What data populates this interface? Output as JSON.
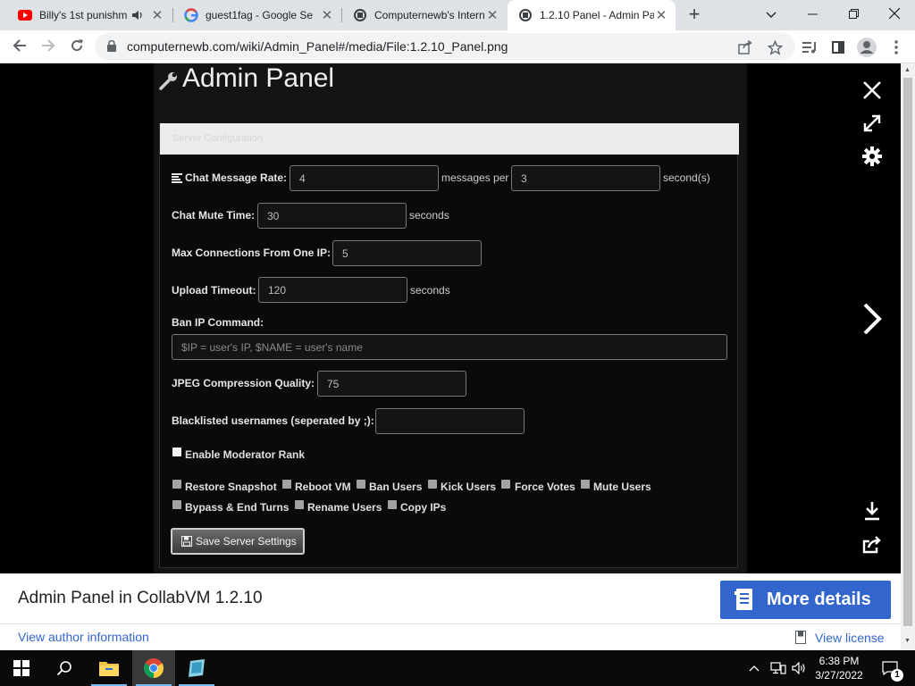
{
  "browser": {
    "tabs": [
      {
        "title": "Billy's 1st punishme",
        "icon": "youtube-icon"
      },
      {
        "title": "guest1fag - Google Se",
        "icon": "google-icon"
      },
      {
        "title": "Computernewb's Intern",
        "icon": "wiki-icon"
      },
      {
        "title": "1.2.10 Panel - Admin Pa",
        "icon": "wiki-icon",
        "active": true
      }
    ],
    "url": "computernewb.com/wiki/Admin_Panel#/media/File:1.2.10_Panel.png"
  },
  "panel": {
    "title": "Admin Panel",
    "card_header": "Server Configuration",
    "chat_rate": {
      "label": "Chat Message Rate:",
      "value1": "4",
      "mid": "messages per",
      "value2": "3",
      "suffix": "second(s)"
    },
    "mute_time": {
      "label": "Chat Mute Time:",
      "value": "30",
      "suffix": "seconds"
    },
    "max_conn": {
      "label": "Max Connections From One IP:",
      "value": "5"
    },
    "upload_timeout": {
      "label": "Upload Timeout:",
      "value": "120",
      "suffix": "seconds"
    },
    "ban_ip": {
      "label": "Ban IP Command:",
      "placeholder": "$IP = user's IP, $NAME = user's name"
    },
    "jpeg": {
      "label": "JPEG Compression Quality:",
      "value": "75"
    },
    "blacklist": {
      "label": "Blacklisted usernames (seperated by ;):",
      "value": ""
    },
    "enable_mod": "Enable Moderator Rank",
    "mod_perms": [
      "Restore Snapshot",
      "Reboot VM",
      "Ban Users",
      "Kick Users",
      "Force Votes",
      "Mute Users",
      "Bypass & End Turns",
      "Rename Users",
      "Copy IPs"
    ],
    "save_label": "Save Server Settings"
  },
  "footer": {
    "caption": "Admin Panel in CollabVM 1.2.10",
    "more_details": "More details",
    "author_link": "View author information",
    "license_link": "View license"
  },
  "taskbar": {
    "time": "6:38 PM",
    "date": "3/27/2022",
    "notification_count": "1"
  },
  "colors": {
    "accent": "#3366cc",
    "panel_bg": "#141414",
    "chrome_tab_strip": "#dee1e6"
  }
}
